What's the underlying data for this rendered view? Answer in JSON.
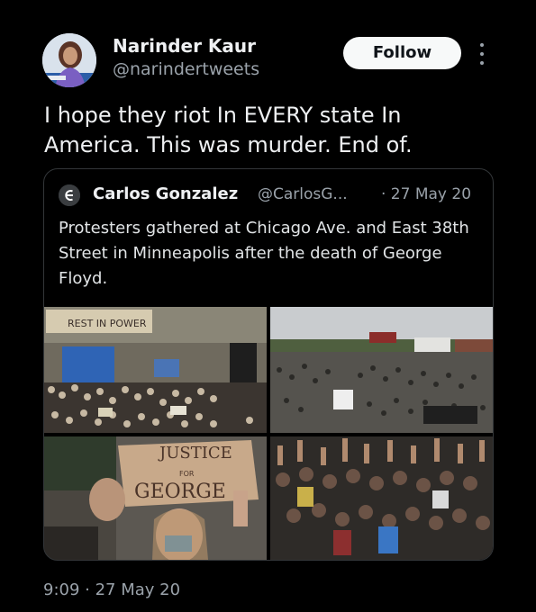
{
  "tweet": {
    "author_name": "Narinder Kaur",
    "author_handle": "@narindertweets",
    "follow_label": "Follow",
    "text": "I hope they riot In EVERY state In America. This was murder. End of.",
    "timestamp": "9:09 · 27 May 20"
  },
  "quoted": {
    "author_name": "Carlos Gonzalez",
    "author_handle": "@CarlosG...",
    "date": "· 27 May 20",
    "text": "Protesters gathered at Chicago Ave. and East 38th Street in Minneapolis after the death of George Floyd.",
    "photos": {
      "sign_text_1": "JUSTICE",
      "sign_text_2": "FOR",
      "sign_text_3": "GEORGE",
      "banner_text": "REST IN POWER"
    }
  },
  "icons": [
    "avatar",
    "more-options-icon",
    "quoted-avatar"
  ],
  "colors": {
    "background": "#000000",
    "text": "#e7e9ea",
    "secondary_text": "#9aa2aa",
    "follow_button": "#f7f9f9",
    "border": "#333639"
  }
}
